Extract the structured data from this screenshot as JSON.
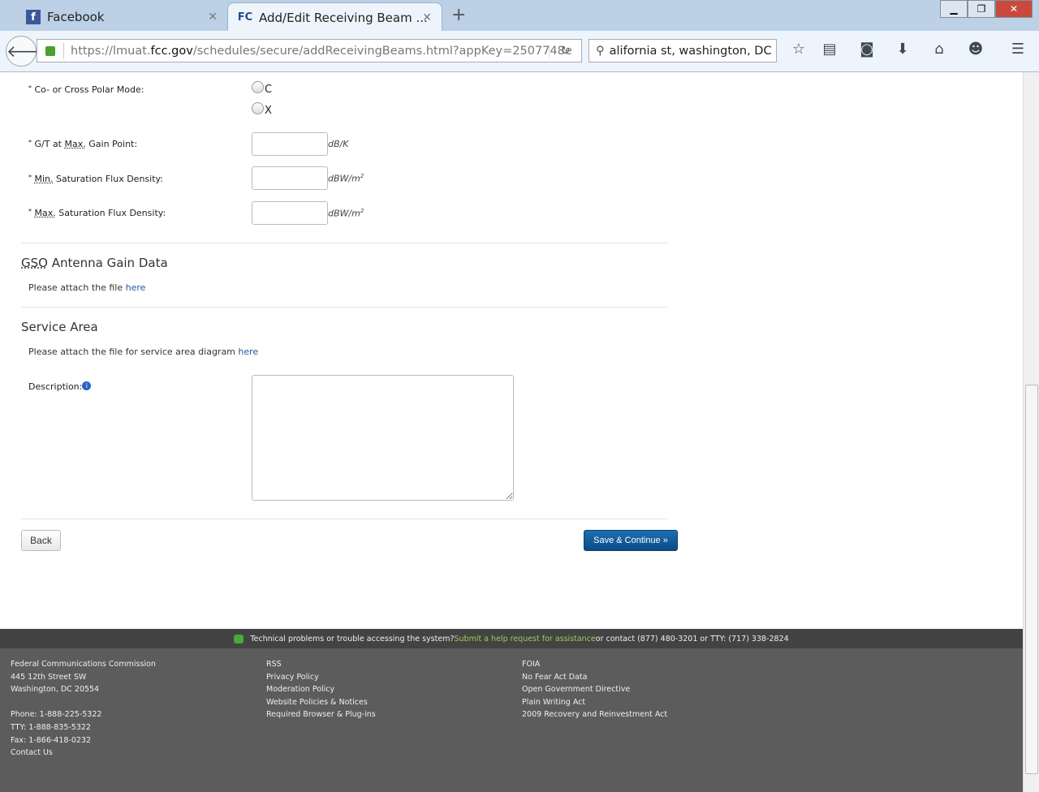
{
  "browser": {
    "tabs": [
      {
        "label": "Facebook",
        "icon": "facebook-icon"
      },
      {
        "label": "Add/Edit Receiving Beam ...",
        "icon": "fcc-icon"
      }
    ],
    "url_prefix": "https://lmuat.",
    "url_host": "fcc.gov",
    "url_path": "/schedules/secure/addReceivingBeams.html?appKey=2507748e",
    "search_value": "alifornia st, washington, DC",
    "toolbar_icons": [
      "bookmark-star-icon",
      "reading-list-icon",
      "pocket-icon",
      "download-icon",
      "home-icon",
      "smiley-icon",
      "menu-icon"
    ]
  },
  "form": {
    "polar_label": "Co- or Cross Polar Mode:",
    "polar_options": [
      "C",
      "X"
    ],
    "gt_label_pre": "G/T at ",
    "gt_label_abbr": "Max.",
    "gt_label_post": " Gain Point:",
    "gt_unit": "dB/K",
    "min_label_abbr": "Min.",
    "min_label_post": " Saturation Flux Density:",
    "min_unit": "dBW/m",
    "unit_sup": "2",
    "max_label_abbr": "Max.",
    "max_label_post": " Saturation Flux Density:",
    "max_unit": "dBW/m",
    "gso_abbr": "GSO",
    "gso_title": " Antenna Gain Data",
    "gso_text": "Please attach the file ",
    "link_here": "here",
    "service_title": "Service Area",
    "service_text": "Please attach the file for service area diagram ",
    "desc_label": "Description:",
    "info": "i",
    "back": "Back",
    "save": "Save & Continue »",
    "required": "*"
  },
  "footer": {
    "help_text": "Technical problems or trouble accessing the system? ",
    "help_link": "Submit a help request for assistance",
    "help_contact": " or contact (877) 480-3201 or TTY: (717) 338-2824",
    "col1": [
      "Federal Communications Commission",
      "445 12th Street SW",
      "Washington, DC 20554",
      "",
      "Phone: 1-888-225-5322",
      "TTY: 1-888-835-5322",
      "Fax: 1-866-418-0232",
      "Contact Us"
    ],
    "col2": [
      "RSS",
      "Privacy Policy",
      "Moderation Policy",
      "Website Policies & Notices",
      "Required Browser & Plug-ins"
    ],
    "col3": [
      "FOIA",
      "No Fear Act Data",
      "Open Government Directive",
      "Plain Writing Act",
      "2009 Recovery and Reinvestment Act"
    ]
  }
}
